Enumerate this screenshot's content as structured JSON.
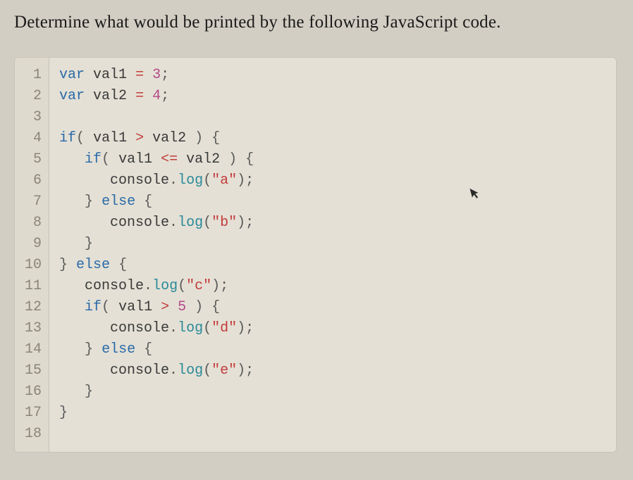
{
  "question": "Determine what would be printed by the following JavaScript code.",
  "lineNumbers": [
    "1",
    "2",
    "3",
    "4",
    "5",
    "6",
    "7",
    "8",
    "9",
    "10",
    "11",
    "12",
    "13",
    "14",
    "15",
    "16",
    "17",
    "18"
  ],
  "code": {
    "l1": {
      "kw": "var",
      "v": "val1",
      "op": "=",
      "n": "3",
      "sc": ";"
    },
    "l2": {
      "kw": "var",
      "v": "val2",
      "op": "=",
      "n": "4",
      "sc": ";"
    },
    "l4": {
      "kw": "if",
      "v1": "val1",
      "op": ">",
      "v2": "val2"
    },
    "l5": {
      "kw": "if",
      "v1": "val1",
      "op": "<=",
      "v2": "val2"
    },
    "l6": {
      "obj": "console",
      "fn": "log",
      "str": "\"a\""
    },
    "l7": {
      "kw": "else"
    },
    "l8": {
      "obj": "console",
      "fn": "log",
      "str": "\"b\""
    },
    "l10": {
      "kw": "else"
    },
    "l11": {
      "obj": "console",
      "fn": "log",
      "str": "\"c\""
    },
    "l12": {
      "kw": "if",
      "v1": "val1",
      "op": ">",
      "n": "5"
    },
    "l13": {
      "obj": "console",
      "fn": "log",
      "str": "\"d\""
    },
    "l14": {
      "kw": "else"
    },
    "l15": {
      "obj": "console",
      "fn": "log",
      "str": "\"e\""
    }
  }
}
